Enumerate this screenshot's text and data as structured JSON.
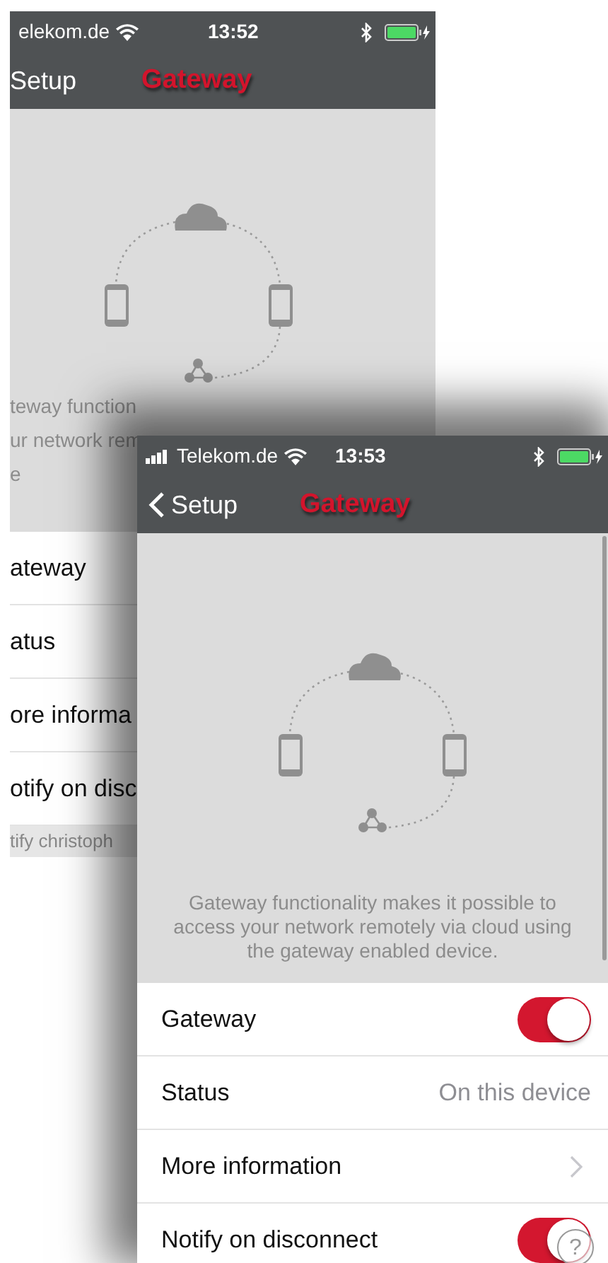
{
  "screens": [
    {
      "status_bar": {
        "signal_icon": false,
        "carrier": "elekom.de",
        "time": "13:52"
      },
      "nav": {
        "back_chevron": false,
        "back": "Setup",
        "title": "Gateway"
      },
      "description_lines": [
        "teway function",
        "ur network rem",
        "e"
      ],
      "rows": [
        {
          "kind": "plain",
          "label": "ateway"
        },
        {
          "kind": "plain",
          "label": "atus"
        },
        {
          "kind": "plain",
          "label": "ore informa"
        },
        {
          "kind": "plain",
          "label": "otify on disc"
        }
      ],
      "footer": "tify christoph"
    },
    {
      "status_bar": {
        "signal_icon": true,
        "carrier": "Telekom.de",
        "time": "13:53"
      },
      "nav": {
        "back_chevron": true,
        "back": "Setup",
        "title": "Gateway"
      },
      "description": "Gateway functionality makes it possible to access your network remotely via cloud using the gateway enabled device.",
      "rows": [
        {
          "kind": "toggle",
          "label": "Gateway",
          "on": true
        },
        {
          "kind": "value",
          "label": "Status",
          "value": "On this device"
        },
        {
          "kind": "link",
          "label": "More information"
        },
        {
          "kind": "toggle",
          "label": "Notify on disconnect",
          "on": true
        }
      ],
      "help_button": "?"
    }
  ]
}
